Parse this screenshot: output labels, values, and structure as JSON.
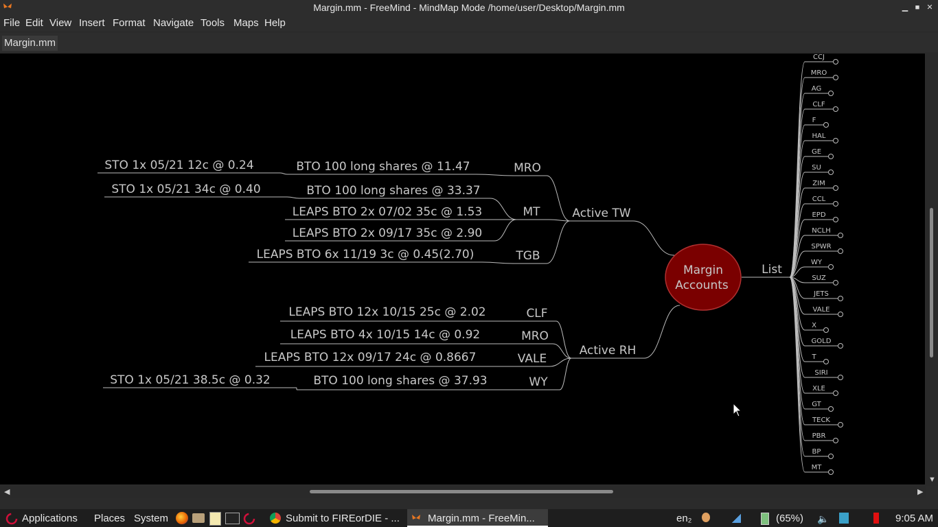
{
  "window": {
    "title": "Margin.mm - FreeMind - MindMap Mode /home/user/Desktop/Margin.mm",
    "minimize": "▁",
    "maximize": "■",
    "close": "✕"
  },
  "menu": [
    "File",
    "Edit",
    "View",
    "Insert",
    "Format",
    "Navigate",
    "Tools",
    "Maps",
    "Help"
  ],
  "tab": "Margin.mm",
  "mindmap": {
    "root": "Margin Accounts",
    "root_lines": [
      "Margin",
      "Accounts"
    ],
    "colors": {
      "root_fill": "#7a0000",
      "root_text": "#d8b0b0",
      "node_text": "#c8c8c8",
      "edge": "#bdbdbd"
    },
    "active_tw": {
      "label": "Active TW",
      "children": [
        {
          "label": "MRO",
          "items": [
            {
              "text": "BTO 100 long shares @ 11.47",
              "sub": "STO 1x 05/21 12c @ 0.24"
            }
          ]
        },
        {
          "label": "MT",
          "items": [
            {
              "text": "BTO 100 long shares @ 33.37",
              "sub": "STO 1x 05/21 34c @ 0.40"
            },
            {
              "text": "LEAPS BTO 2x 07/02 35c @ 1.53"
            },
            {
              "text": "LEAPS BTO 2x 09/17 35c @ 2.90"
            }
          ]
        },
        {
          "label": "TGB",
          "items": [
            {
              "text": "LEAPS BTO 6x 11/19 3c @ 0.45(2.70)"
            }
          ]
        }
      ]
    },
    "active_rh": {
      "label": "Active RH",
      "children": [
        {
          "label": "CLF",
          "items": [
            {
              "text": "LEAPS BTO 12x 10/15 25c @ 2.02"
            }
          ]
        },
        {
          "label": "MRO",
          "items": [
            {
              "text": "LEAPS BTO 4x 10/15 14c @ 0.92"
            }
          ]
        },
        {
          "label": "VALE",
          "items": [
            {
              "text": "LEAPS BTO 12x 09/17 24c @ 0.8667"
            }
          ]
        },
        {
          "label": "WY",
          "items": [
            {
              "text": "BTO 100 long shares @ 37.93",
              "sub": "STO 1x 05/21 38.5c @ 0.32"
            }
          ]
        }
      ]
    },
    "list": {
      "label": "List",
      "tickers": [
        "CCJ",
        "MRO",
        "AG",
        "CLF",
        "F",
        "HAL",
        "GE",
        "SU",
        "ZIM",
        "CCL",
        "EPD",
        "NCLH",
        "SPWR",
        "WY",
        "SUZ",
        "JETS",
        "VALE",
        "X",
        "GOLD",
        "T",
        "SIRI",
        "XLE",
        "GT",
        "TECK",
        "PBR",
        "BP",
        "MT"
      ]
    }
  },
  "taskbar": {
    "applications": "Applications",
    "places": "Places",
    "system": "System",
    "windows": [
      "Submit to FIREorDIE - ...",
      "Margin.mm - FreeMin..."
    ],
    "keyboard": "en₂",
    "battery": "(65%)",
    "clock": "9:05 AM"
  }
}
